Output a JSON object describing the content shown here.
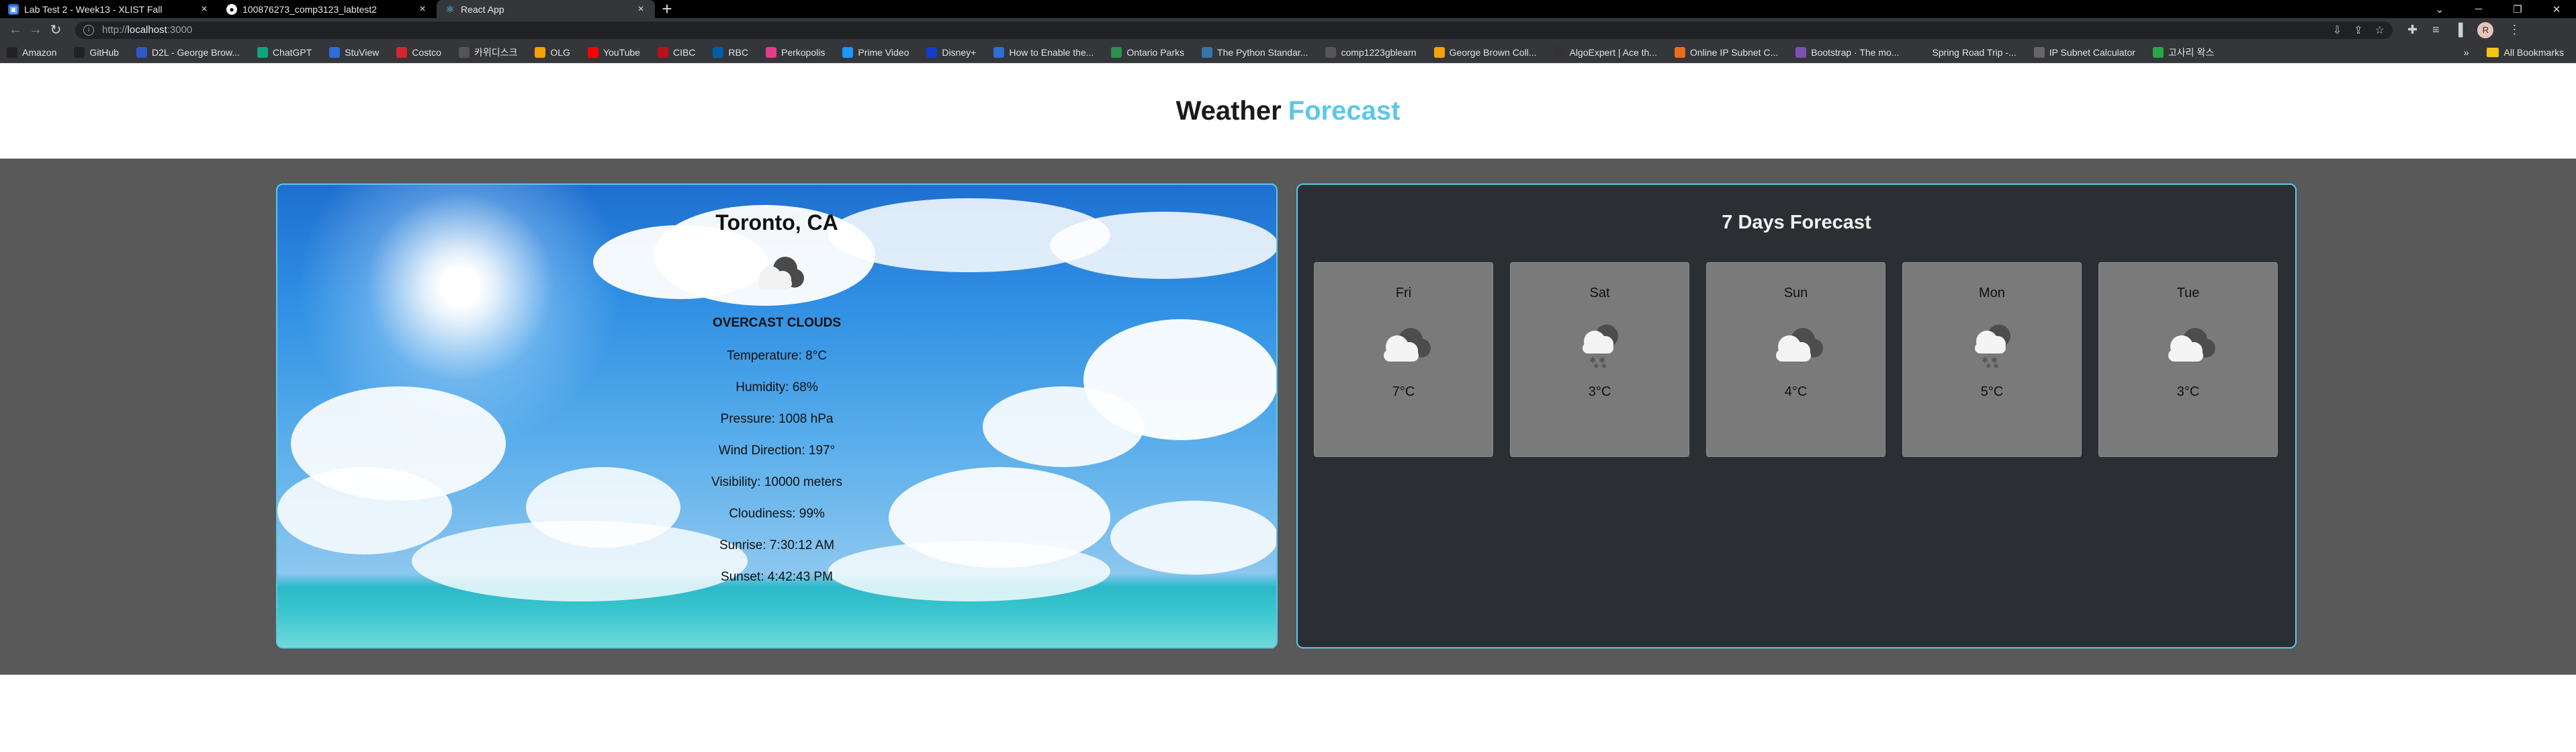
{
  "browser": {
    "tabs": [
      {
        "title": "Lab Test 2 - Week13 - XLIST Fall",
        "active": false,
        "favicon_color": "#2a6fd6"
      },
      {
        "title": "100876273_comp3123_labtest2",
        "active": false,
        "favicon_color": "#ffffff"
      },
      {
        "title": "React App",
        "active": true,
        "favicon_color": "#61dafb"
      }
    ],
    "url": "http://localhost:3000",
    "url_scheme": "http://",
    "url_host": "localhost",
    "url_port": ":3000",
    "profile_initial": "R",
    "bookmarks": [
      {
        "label": "Amazon",
        "color": "#222"
      },
      {
        "label": "GitHub",
        "color": "#222"
      },
      {
        "label": "D2L - George Brow...",
        "color": "#2f57c9"
      },
      {
        "label": "ChatGPT",
        "color": "#10a37f"
      },
      {
        "label": "StuView",
        "color": "#2d6ed8"
      },
      {
        "label": "Costco",
        "color": "#d0262e"
      },
      {
        "label": "카위디스크",
        "color": "#555"
      },
      {
        "label": "OLG",
        "color": "#f4a300"
      },
      {
        "label": "YouTube",
        "color": "#ff0000"
      },
      {
        "label": "CIBC",
        "color": "#b5121b"
      },
      {
        "label": "RBC",
        "color": "#005daa"
      },
      {
        "label": "Perkopolis",
        "color": "#e23e8a"
      },
      {
        "label": "Prime Video",
        "color": "#1a98ff"
      },
      {
        "label": "Disney+",
        "color": "#113ccf"
      },
      {
        "label": "How to Enable the...",
        "color": "#2d6ed8"
      },
      {
        "label": "Ontario Parks",
        "color": "#2f8f4e"
      },
      {
        "label": "The Python Standar...",
        "color": "#3776ab"
      },
      {
        "label": "comp1223gblearn",
        "color": "#555"
      },
      {
        "label": "George Brown Coll...",
        "color": "#f4a300"
      },
      {
        "label": "AlgoExpert | Ace th...",
        "color": "#333"
      },
      {
        "label": "Online IP Subnet C...",
        "color": "#e86e1c"
      },
      {
        "label": "Bootstrap · The mo...",
        "color": "#7952b3"
      },
      {
        "label": "Spring Road Trip -...",
        "color": "#35363a"
      },
      {
        "label": "IP Subnet Calculator",
        "color": "#666"
      },
      {
        "label": "고사리 왁스",
        "color": "#2aa745"
      }
    ],
    "all_bookmarks": "All Bookmarks",
    "overflow": "»"
  },
  "header": {
    "title_main": "Weather",
    "title_accent": "Forecast"
  },
  "current": {
    "city": "Toronto, CA",
    "icon": "overcast-clouds-icon",
    "description": "OVERCAST CLOUDS",
    "stats": [
      "Temperature: 8°C",
      "Humidity: 68%",
      "Pressure: 1008 hPa",
      "Wind Direction: 197°",
      "Visibility: 10000 meters",
      "Cloudiness: 99%",
      "Sunrise: 7:30:12 AM",
      "Sunset: 4:42:43 PM"
    ]
  },
  "forecast": {
    "title": "7 Days Forecast",
    "days": [
      {
        "day": "Fri",
        "temp": "7°C",
        "icon": "broken-clouds-icon"
      },
      {
        "day": "Sat",
        "temp": "3°C",
        "icon": "snow-icon"
      },
      {
        "day": "Sun",
        "temp": "4°C",
        "icon": "broken-clouds-icon"
      },
      {
        "day": "Mon",
        "temp": "5°C",
        "icon": "snow-icon"
      },
      {
        "day": "Tue",
        "temp": "3°C",
        "icon": "broken-clouds-icon"
      }
    ]
  },
  "colors": {
    "accent": "#5bc8e8",
    "panel_bg": "#2b2f33",
    "main_bg": "#595959",
    "day_card": "#7a7a7a"
  }
}
